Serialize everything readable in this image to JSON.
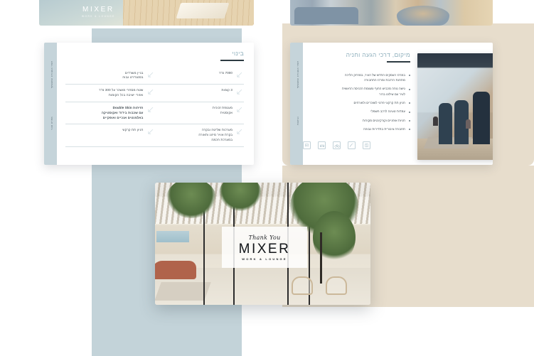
{
  "brand": {
    "name": "MIXER",
    "tagline": "WORK & LOUNGE"
  },
  "background": {
    "blue_panel_color": "#c3d3d9",
    "beige_panel_color": "#e7ddcc",
    "page_color": "#ffffff"
  },
  "banners": {
    "left": {
      "alt": "wood-slat-interior-photo",
      "logo": "MIXER",
      "logo_sub": "WORK & LOUNGE"
    },
    "right": {
      "alt": "lounge-seating-photo"
    }
  },
  "slides": {
    "construction": {
      "title": "בינוי",
      "rail_top": "אתר העבודה המשותף",
      "rail_bottom": "מפרט טכני",
      "rows": [
        {
          "right": {
            "text": "7000 מ\"ר",
            "icon": "arrow-diagonal-icon",
            "bold": false
          },
          "left": {
            "text": "בניין משרדים\nבסטנדרט גבוה",
            "icon": "arrow-diagonal-icon",
            "bold": false
          }
        },
        {
          "right": {
            "text": "3 קומות",
            "icon": "arrow-diagonal-icon",
            "bold": false
          },
          "left": {
            "text": "שטח מסחרי מושכר על 300 מ\"ר\nואזורי ישיבה בכל הקומות",
            "icon": "arrow-diagonal-icon",
            "bold": false
          }
        },
        {
          "right": {
            "text": "מעטפת זכוכית\nאקוסטית",
            "icon": "arrow-diagonal-icon",
            "bold": false
          },
          "left": {
            "text": "חזיתות Double Skin\nעם שכבות בידוד ואקוסטיקה\nבאלמנטים אנכיים ואופקיים",
            "icon": "arrow-diagonal-icon",
            "bold": true
          }
        },
        {
          "right": {
            "text": "מערכות שליטה ובקרה\nבקרת אוויר מיזוג ותאורה\nבמערכת חכמה",
            "icon": "arrow-diagonal-icon",
            "bold": false
          },
          "left": {
            "text": "חניון תת קרקעי",
            "icon": "arrow-diagonal-icon",
            "bold": false
          }
        }
      ]
    },
    "location": {
      "title": "מיקום, דרכי הגעה וחניה",
      "rail_top": "אתר העבודה המשותף",
      "rail_bottom": "נגישות",
      "bullets": [
        "במרכז העסקים החדש של העיר, במרחק הליכה\nמתחנת הרכבת ומרכז התחבורה",
        "גישה נוחה מכביש החוף ומצומת הכניסה הראשית\nלעיר עם שילוט ברור",
        "חניון תת קרקעי פרטי לשוכרים ולאורחים",
        "עמדות טעינה לרכב חשמלי",
        "חניות אופניים וקורקינטים מקורות",
        "תחבורה ציבורית בתדירות גבוהה"
      ],
      "icons": [
        "train-icon",
        "car-icon",
        "bicycle-icon",
        "stairs-icon",
        "elevator-icon"
      ],
      "photo_alt": "office-booths-photo"
    },
    "thank_you": {
      "script_text": "Thank You",
      "brand": "MIXER",
      "tagline": "WORK & LOUNGE",
      "photo_alt": "green-atrium-lounge-photo"
    }
  }
}
